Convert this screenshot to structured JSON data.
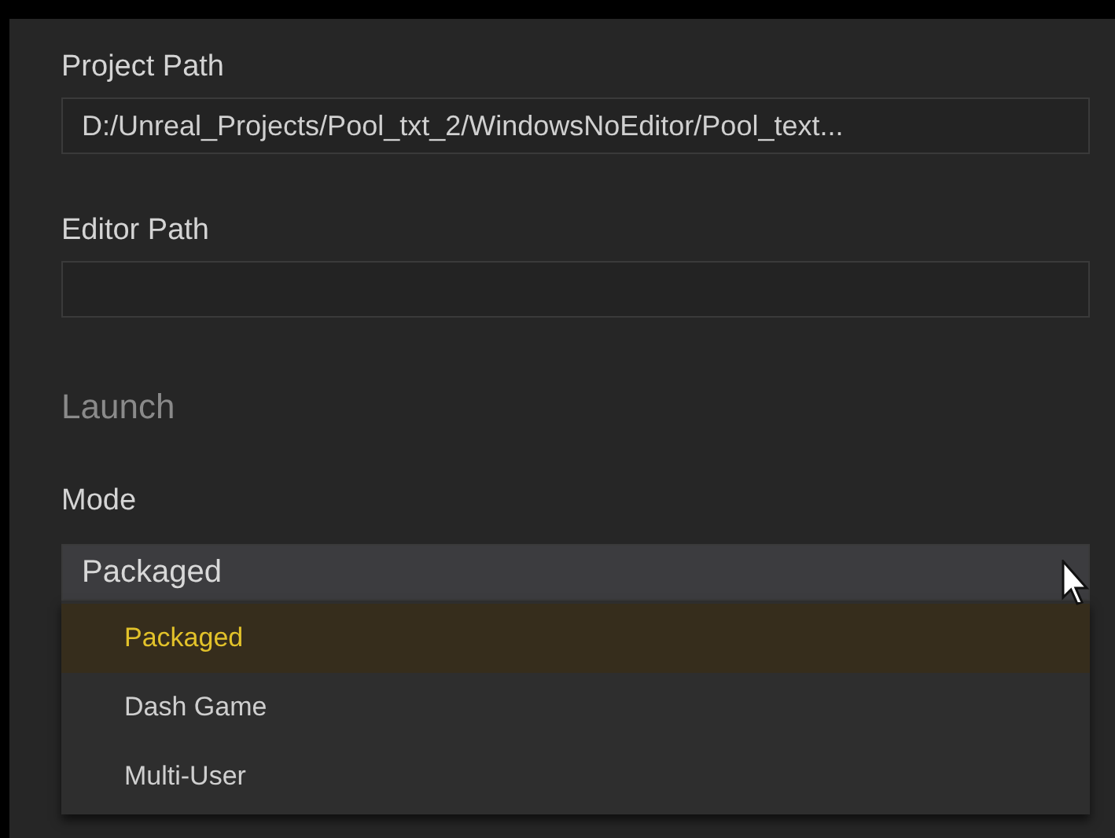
{
  "fields": [
    {
      "label": "Project Path",
      "value": "D:/Unreal_Projects/Pool_txt_2/WindowsNoEditor/Pool_text..."
    },
    {
      "label": "Editor Path"
    }
  ],
  "section": {
    "title": "Launch"
  },
  "mode": {
    "label": "Mode",
    "value": "Packaged",
    "expanded": true,
    "options": [
      {
        "label": "Packaged",
        "selected": true
      },
      {
        "label": "Dash Game",
        "selected": false
      },
      {
        "label": "Multi-User",
        "selected": false
      }
    ]
  }
}
